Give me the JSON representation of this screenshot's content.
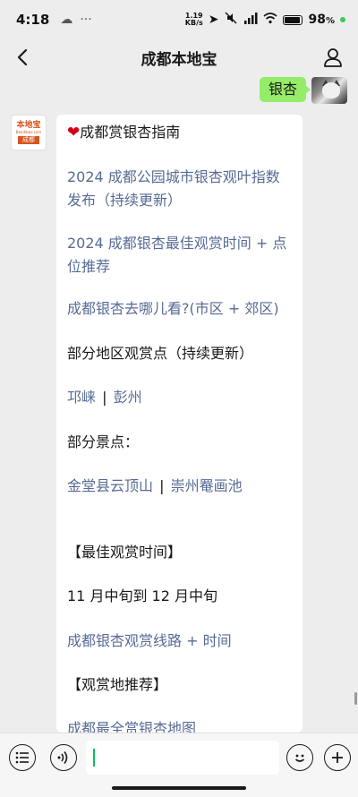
{
  "status": {
    "time": "4:18",
    "net_speed_value": "1.19",
    "net_speed_unit": "KB/s",
    "battery_pct": "98"
  },
  "nav": {
    "title": "成都本地宝"
  },
  "me": {
    "message": "银杏"
  },
  "bot": {
    "logo_top": "本地宝",
    "logo_mid": "Bendibao.com",
    "logo_bottom": "成都"
  },
  "card": {
    "heading": "成都赏银杏指南",
    "links": [
      "2024 成都公园城市银杏观叶指数发布（持续更新）",
      "2024 成都银杏最佳观赏时间 + 点位推荐",
      "成都银杏去哪儿看?(市区 + 郊区)"
    ],
    "section_area": "部分地区观赏点（持续更新）",
    "area_links": [
      "邛崃",
      "彭州"
    ],
    "section_spots": "部分景点：",
    "spot_links": [
      "金堂县云顶山",
      "崇州罨画池"
    ],
    "section_best_time": "【最佳观赏时间】",
    "best_time": "11 月中旬到 12 月中旬",
    "route_link": "成都银杏观赏线路 + 时间",
    "section_places": "【观赏地推荐】",
    "map_link": "成都最全赏银杏地图"
  },
  "icons": [
    "back-icon",
    "profile-icon",
    "heart-icon",
    "menu-icon",
    "voice-icon",
    "emoji-icon",
    "add-icon"
  ],
  "colors": {
    "link": "#576b95",
    "my_bubble": "#95ec69",
    "background": "#ededed",
    "brand": "#d9531e"
  }
}
